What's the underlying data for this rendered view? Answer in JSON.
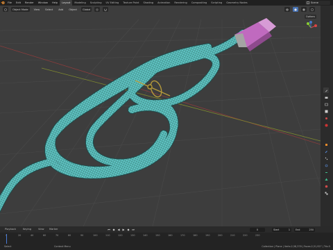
{
  "topbar": {
    "menus": [
      "File",
      "Edit",
      "Render",
      "Window",
      "Help"
    ],
    "workspaces": [
      "Layout",
      "Modeling",
      "Sculpting",
      "UV Editing",
      "Texture Paint",
      "Shading",
      "Animation",
      "Rendering",
      "Compositing",
      "Scripting",
      "Geometry Nodes"
    ],
    "active_workspace": "Layout",
    "scene_label": "Scene",
    "icons": [
      "blender-logo-icon",
      "scene-icon",
      "view-layer-icon"
    ]
  },
  "viewport": {
    "mode_label": "Object Mode",
    "menu_items": [
      "View",
      "Select",
      "Add",
      "Object"
    ],
    "transform_label": "Global",
    "options_label": "Options",
    "colors": {
      "background": "#3d3d3d",
      "grid": "#4a4a4a",
      "x_axis": "#8a3d3d",
      "y_axis": "#7f8a2e",
      "cable": "#5fc4c2",
      "cable_wire": "#1f4a4a",
      "connector": "#c06abf",
      "clip": "#b59a3a"
    }
  },
  "right_tools": {
    "icons": [
      "tool-icon",
      "render-icon",
      "output-icon",
      "view-layer-icon",
      "scene-icon",
      "world-icon",
      "object-icon",
      "modifier-icon",
      "particles-icon",
      "physics-icon",
      "constraints-icon",
      "data-icon",
      "material-icon",
      "texture-icon"
    ]
  },
  "playbar": {
    "playback_label": "Playback",
    "keying_label": "Keying",
    "view_label": "View",
    "marker_label": "Marker",
    "current_frame": "0",
    "start_label": "Start",
    "start_value": "1",
    "end_label": "End",
    "end_value": "250"
  },
  "timeline": {
    "ticks": [
      "0",
      "20",
      "40",
      "60",
      "70",
      "80",
      "90",
      "100",
      "110",
      "120",
      "130",
      "140",
      "150",
      "160",
      "170",
      "180",
      "190",
      "200",
      "210",
      "220",
      "230"
    ]
  },
  "statusbar": {
    "left_label": "Select",
    "middle_label": "Context Menu",
    "right_label": "Collection | Plane | Verts:2,58,378 | Faces:2,51,927 | Tris:5"
  }
}
